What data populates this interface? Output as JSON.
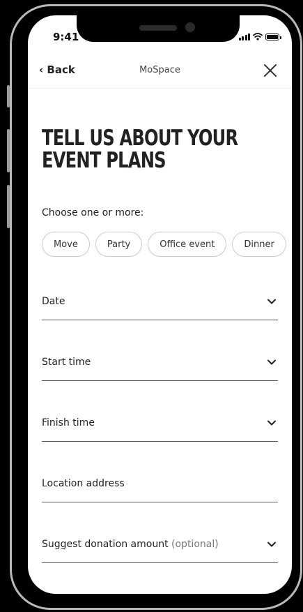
{
  "status": {
    "time": "9:41"
  },
  "nav": {
    "back_label": "‹ Back",
    "title": "MoSpace"
  },
  "heading": {
    "line1": "TELL US ABOUT YOUR",
    "line2": "EVENT PLANS"
  },
  "choose_label": "Choose one or more:",
  "chips": [
    "Move",
    "Party",
    "Office event",
    "Dinner"
  ],
  "fields": {
    "date": "Date",
    "start_time": "Start time",
    "finish_time": "Finish time",
    "location": "Location address",
    "donation": "Suggest donation amount",
    "donation_optional": "(optional)"
  }
}
